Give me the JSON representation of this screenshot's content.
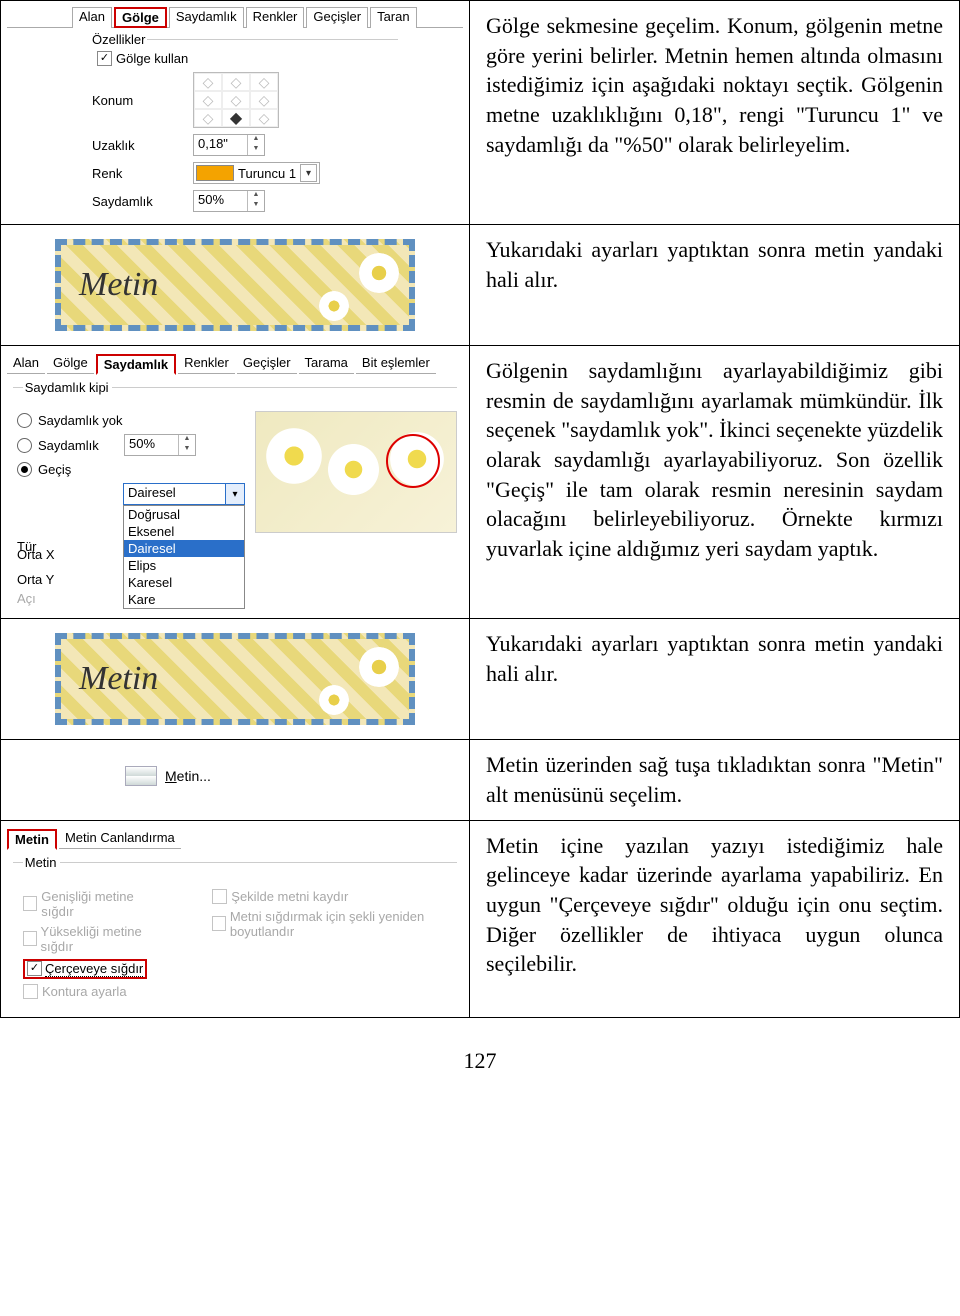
{
  "row1": {
    "tabs": [
      "Alan",
      "Gölge",
      "Saydamlık",
      "Renkler",
      "Geçişler",
      "Taran"
    ],
    "selected_tab": "Gölge",
    "fieldset_label": "Özellikler",
    "use_shadow_label": "Gölge kullan",
    "konum_label": "Konum",
    "uzaklik_label": "Uzaklık",
    "uzaklik_value": "0,18\"",
    "renk_label": "Renk",
    "renk_value": "Turuncu 1",
    "saydamlik_label": "Saydamlık",
    "saydamlik_value": "50%",
    "desc": "Gölge sekmesine geçelim. Konum, gölgenin metne göre yerini belirler. Metnin hemen altında olmasını istediğimiz için aşağıdaki noktayı seçtik. Gölgenin metne uzaklıklığını 0,18\", rengi \"Turuncu 1\" ve saydamlığı da \"%50\" olarak belirleyelim."
  },
  "row2": {
    "metin_text": "Metin",
    "desc": "Yukarıdaki ayarları yaptıktan sonra metin yandaki hali alır."
  },
  "row3": {
    "tabs": [
      "Alan",
      "Gölge",
      "Saydamlık",
      "Renkler",
      "Geçişler",
      "Tarama",
      "Bit eşlemler"
    ],
    "selected_tab": "Saydamlık",
    "fieldset_label": "Saydamlık kipi",
    "radio_none": "Saydamlık yok",
    "radio_pct": "Saydamlık",
    "radio_grad": "Geçiş",
    "pct_value": "50%",
    "tur_label": "Tür",
    "tur_value": "Dairesel",
    "tur_options": [
      "Doğrusal",
      "Eksenel",
      "Dairesel",
      "Elips",
      "Karesel",
      "Kare"
    ],
    "ortax_label": "Orta X",
    "ortay_label": "Orta Y",
    "aci_label": "Açı",
    "desc": "Gölgenin saydamlığını ayarlayabildiğimiz gibi resmin de saydamlığını ayarlamak mümkündür. İlk seçenek \"saydamlık yok\". İkinci seçenekte yüzdelik olarak saydamlığı ayarlayabiliyoruz. Son özellik \"Geçiş\" ile tam olarak resmin neresinin saydam olacağını belirleyebiliyoruz. Örnekte kırmızı yuvarlak içine aldığımız yeri saydam yaptık."
  },
  "row4": {
    "metin_text": "Metin",
    "desc": "Yukarıdaki ayarları yaptıktan sonra metin yandaki hali alır."
  },
  "row5": {
    "menu_label_pre": "M",
    "menu_label_post": "etin...",
    "desc": "Metin üzerinden sağ tuşa tıkladıktan sonra \"Metin\" alt menüsünü seçelim."
  },
  "row6": {
    "tabs": [
      "Metin",
      "Metin Canlandırma"
    ],
    "selected_tab": "Metin",
    "fieldset_label": "Metin",
    "c1a": "Genişliği metine sığdır",
    "c1b": "Yüksekliği metine sığdır",
    "c1c": "Çerçeveye sığdır",
    "c1d": "Kontura ayarla",
    "c2a": "Şekilde metni kaydır",
    "c2b": "Metni sığdırmak için şekli yeniden boyutlandır",
    "desc": "Metin içine yazılan yazıyı istediğimiz hale gelinceye kadar üzerinde ayarlama yapabiliriz. En uygun \"Çerçeveye sığdır\" olduğu için onu seçtim. Diğer özellikler de ihtiyaca uygun olunca seçilebilir."
  },
  "page_number": "127"
}
